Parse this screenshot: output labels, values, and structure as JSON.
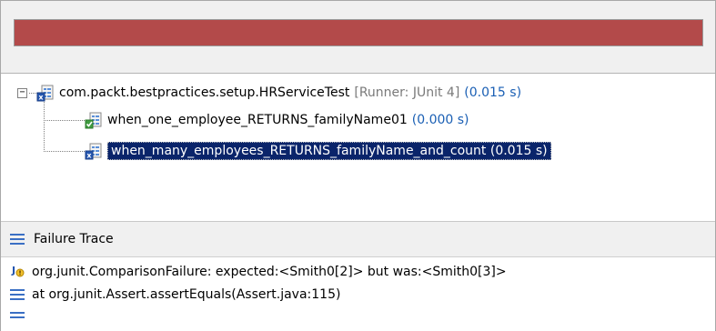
{
  "progress": {
    "status_color": "#b34a4a",
    "state": "failed"
  },
  "tree": {
    "suite": {
      "collapse_glyph": "−",
      "icon": "test-suite-error-icon",
      "name": "com.packt.bestpractices.setup.HRServiceTest",
      "runner": "[Runner: JUnit 4]",
      "time": "(0.015 s)"
    },
    "tests": [
      {
        "icon": "test-passed-icon",
        "name": "when_one_employee_RETURNS_familyName01",
        "time": "(0.000 s)",
        "selected": false
      },
      {
        "icon": "test-failed-icon",
        "name": "when_many_employees_RETURNS_familyName_and_count",
        "time": "(0.015 s)",
        "selected": true
      }
    ]
  },
  "failure_trace": {
    "header_icon": "stack-trace-icon",
    "header_label": "Failure Trace",
    "lines": [
      {
        "icon": "junit-failure-icon",
        "text": "org.junit.ComparisonFailure: expected:<Smith0[2]> but was:<Smith0[3]>"
      },
      {
        "icon": "stack-frame-icon",
        "text": "at org.junit.Assert.assertEquals(Assert.java:115)"
      },
      {
        "icon": "stack-frame-icon",
        "text": ""
      }
    ]
  },
  "colors": {
    "failure_bar": "#b34a4a",
    "selection": "#0a246a",
    "time": "#1a5fb4",
    "runner": "#7a7a7a"
  }
}
